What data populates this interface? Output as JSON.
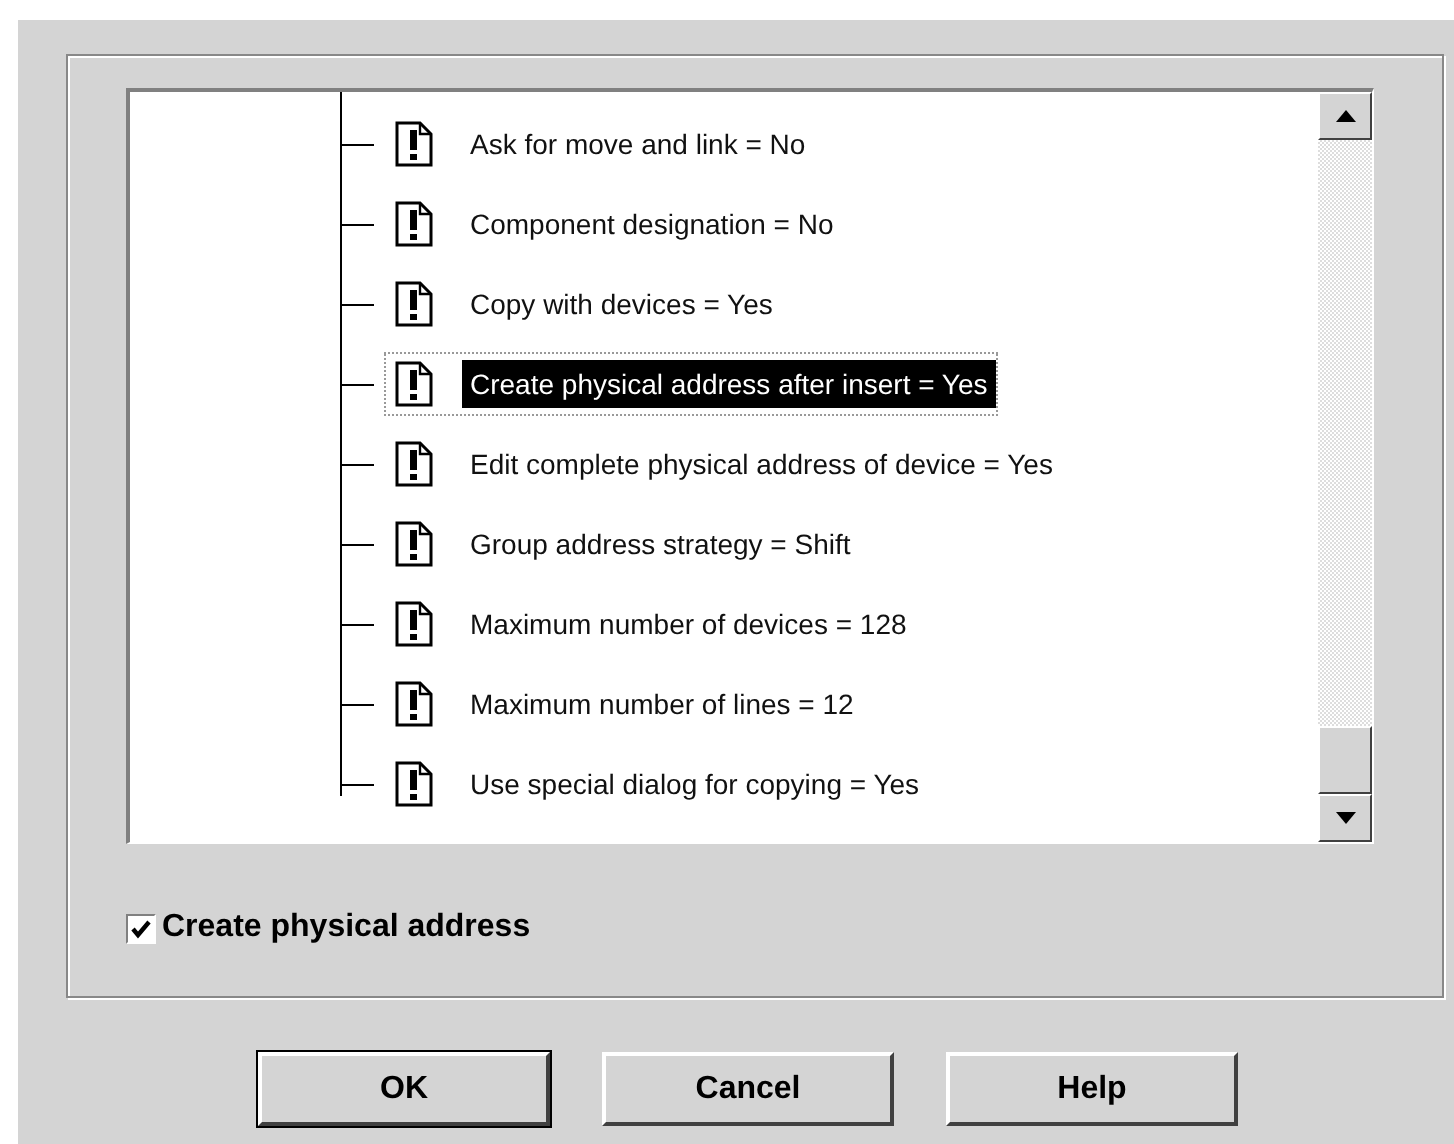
{
  "tree": {
    "items": [
      {
        "label": "Ask for move and link = No",
        "selected": false
      },
      {
        "label": "Component designation = No",
        "selected": false
      },
      {
        "label": "Copy with devices = Yes",
        "selected": false
      },
      {
        "label": "Create physical address after insert = Yes",
        "selected": true
      },
      {
        "label": "Edit complete physical address of device = Yes",
        "selected": false
      },
      {
        "label": "Group address strategy = Shift",
        "selected": false
      },
      {
        "label": "Maximum number of devices = 128",
        "selected": false
      },
      {
        "label": "Maximum number of lines = 12",
        "selected": false
      },
      {
        "label": "Use special dialog for copying = Yes",
        "selected": false
      }
    ]
  },
  "checkbox": {
    "label": "Create physical address",
    "checked": true
  },
  "buttons": [
    {
      "label": "OK",
      "default": true
    },
    {
      "label": "Cancel",
      "default": false
    },
    {
      "label": "Help",
      "default": false
    }
  ]
}
